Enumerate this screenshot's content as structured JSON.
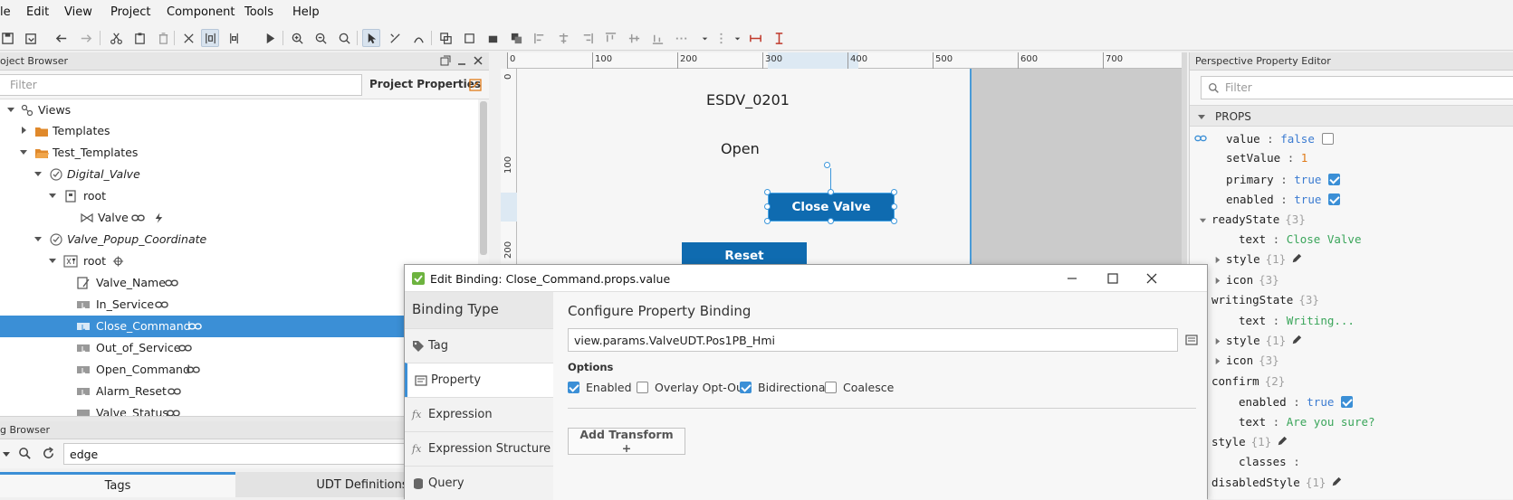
{
  "menu": [
    "le",
    "Edit",
    "View",
    "Project",
    "Component",
    "Tools",
    "Help"
  ],
  "project_browser": {
    "title": "oject Browser",
    "filter_placeholder": "Filter",
    "project_properties": "Project Properties",
    "tree": [
      {
        "label": "Views",
        "italic": false
      },
      {
        "label": "Templates",
        "italic": false
      },
      {
        "label": "Test_Templates",
        "italic": false
      },
      {
        "label": "Digital_Valve",
        "italic": true
      },
      {
        "label": "root",
        "italic": false
      },
      {
        "label": "Valve",
        "italic": false
      },
      {
        "label": "Valve_Popup_Coordinate",
        "italic": true
      },
      {
        "label": "root",
        "italic": false
      },
      {
        "label": "Valve_Name",
        "italic": false
      },
      {
        "label": "In_Service",
        "italic": false
      },
      {
        "label": "Close_Command",
        "italic": false
      },
      {
        "label": "Out_of_Service",
        "italic": false
      },
      {
        "label": "Open_Command",
        "italic": false
      },
      {
        "label": "Alarm_Reset",
        "italic": false
      },
      {
        "label": "Valve_Status",
        "italic": false
      }
    ]
  },
  "tag_browser": {
    "title": "g Browser",
    "search_value": "edge",
    "tabs": [
      "Tags",
      "UDT Definitions"
    ]
  },
  "canvas": {
    "ruler_top": [
      "0",
      "100",
      "200",
      "300",
      "400",
      "500",
      "600",
      "700"
    ],
    "ruler_left": [
      "0",
      "100",
      "200"
    ],
    "label_name": "ESDV_0201",
    "label_status": "Open",
    "close_button": "Close Valve",
    "reset_button": "Reset"
  },
  "property_editor": {
    "title": "Perspective Property Editor",
    "filter_placeholder": "Filter",
    "section": "PROPS",
    "rows": [
      {
        "key": "value",
        "val": "false",
        "kind": "kw",
        "checkbox": "off"
      },
      {
        "key": "setValue",
        "val": "1",
        "kind": "num"
      },
      {
        "key": "primary",
        "val": "true",
        "kind": "kw",
        "checkbox": "on"
      },
      {
        "key": "enabled",
        "val": "true",
        "kind": "kw",
        "checkbox": "on"
      },
      {
        "key": "readyState",
        "count": "{3}"
      },
      {
        "key": "text",
        "val": "Close Valve",
        "kind": "str"
      },
      {
        "key": "style",
        "count": "{1}"
      },
      {
        "key": "icon",
        "count": "{3}"
      },
      {
        "key": "writingState",
        "count": "{3}"
      },
      {
        "key": "text",
        "val": "Writing...",
        "kind": "str"
      },
      {
        "key": "style",
        "count": "{1}"
      },
      {
        "key": "icon",
        "count": "{3}"
      },
      {
        "key": "confirm",
        "count": "{2}"
      },
      {
        "key": "enabled",
        "val": "true",
        "kind": "kw",
        "checkbox": "on"
      },
      {
        "key": "text",
        "val": "Are you sure?",
        "kind": "str"
      },
      {
        "key": "style",
        "count": "{1}"
      },
      {
        "key": "classes",
        "val": "",
        "kind": "str"
      },
      {
        "key": "disabledStyle",
        "count": "{1}"
      }
    ]
  },
  "dialog": {
    "title": "Edit Binding: Close_Command.props.value",
    "binding_type_title": "Binding Type",
    "binding_types": [
      "Tag",
      "Property",
      "Expression",
      "Expression Structure",
      "Query"
    ],
    "selected_binding": "Property",
    "config_title": "Configure Property Binding",
    "property_path": "view.params.ValveUDT.Pos1PB_Hmi",
    "options_label": "Options",
    "options": [
      {
        "label": "Enabled",
        "checked": true
      },
      {
        "label": "Overlay Opt-Out",
        "checked": false
      },
      {
        "label": "Bidirectional",
        "checked": true
      },
      {
        "label": "Coalesce",
        "checked": false
      }
    ],
    "add_transform": "Add Transform +"
  },
  "colors": {
    "accent": "#3b8fd6",
    "button_fill": "#0f6bb0",
    "keyword": "#3b7bd1",
    "number": "#e07b1a",
    "string": "#3aa55a"
  }
}
